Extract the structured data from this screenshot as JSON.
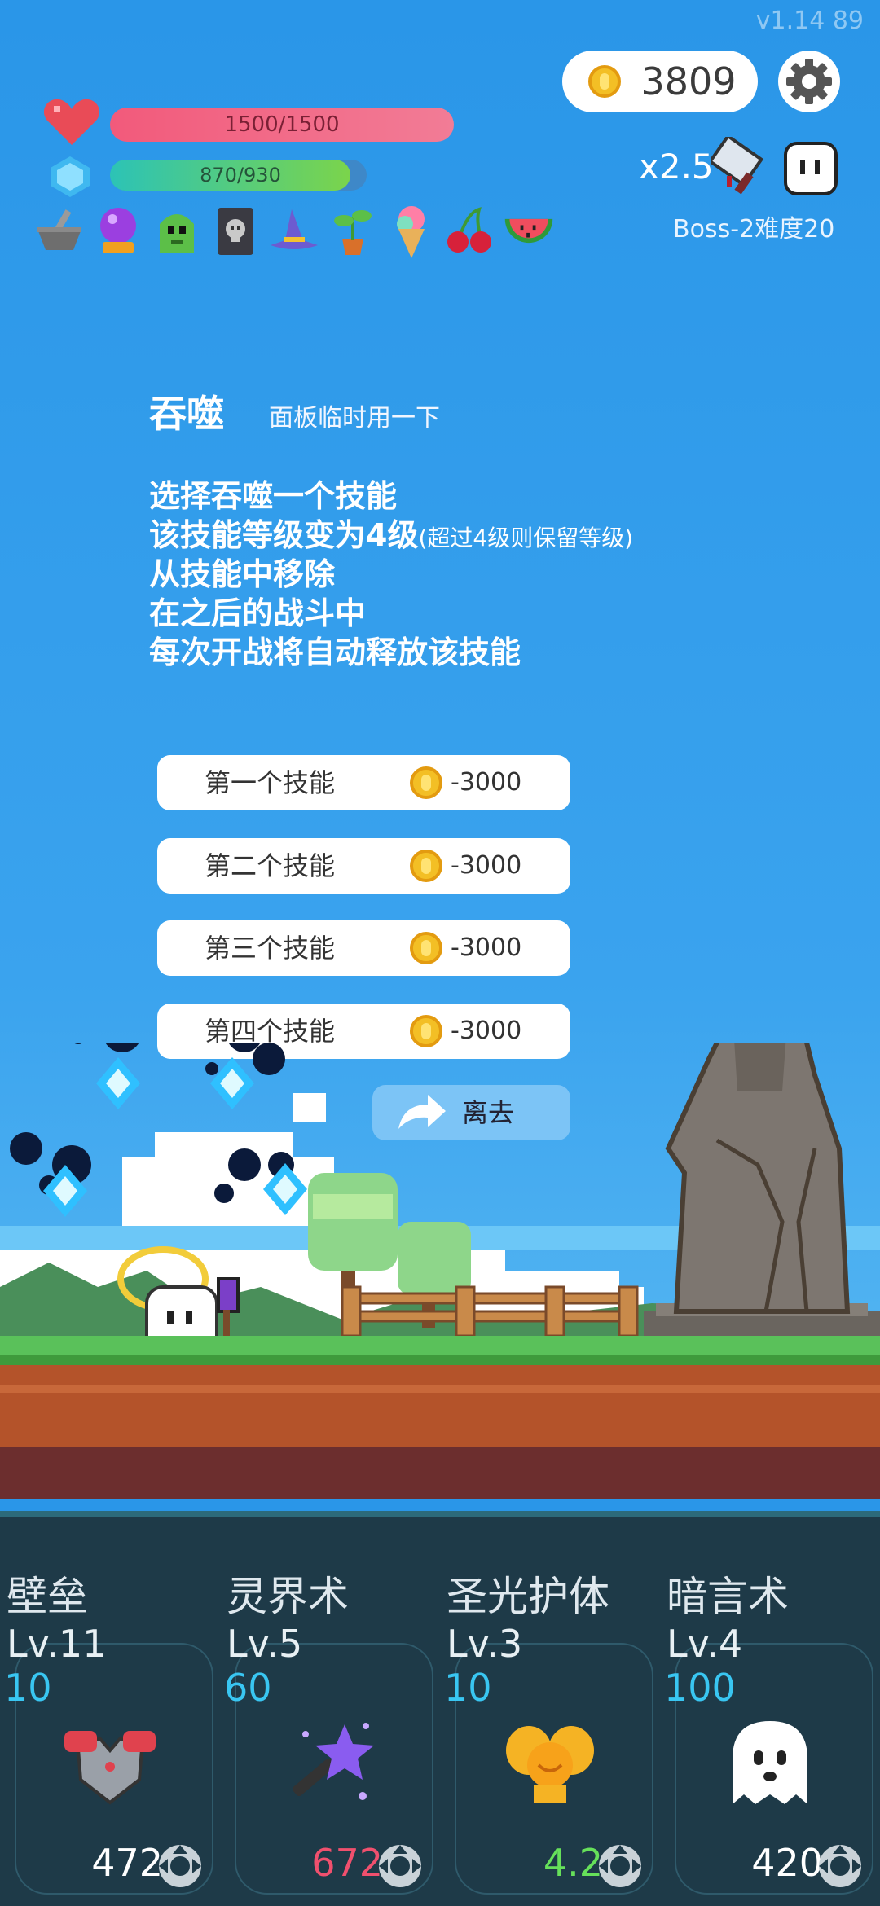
{
  "version": "v1.14   89",
  "coins": "3809",
  "hp": "1500/1500",
  "mp": "870/930",
  "mp_fraction": 0.935,
  "multiplier": "x2.5",
  "boss_info": "Boss-2难度20",
  "items": [
    "mortar",
    "crystal-ball",
    "slime",
    "skull-book",
    "wizard-hat",
    "sprout",
    "ice-cream",
    "cherries",
    "watermelon"
  ],
  "panel": {
    "title": "吞噬",
    "subtitle": "面板临时用一下",
    "lines": [
      "选择吞噬一个技能",
      "该技能等级变为4级",
      "(超过4级则保留等级)",
      "从技能中移除",
      "在之后的战斗中",
      "每次开战将自动释放该技能"
    ]
  },
  "options": [
    {
      "label": "第一个技能",
      "price": "-3000"
    },
    {
      "label": "第二个技能",
      "price": "-3000"
    },
    {
      "label": "第三个技能",
      "price": "-3000"
    },
    {
      "label": "第四个技能",
      "price": "-3000"
    }
  ],
  "leave_label": "离去",
  "skills": [
    {
      "name": "壁垒",
      "level": "Lv.11",
      "cost": "10",
      "value": "472",
      "value_color": "#ffffff",
      "icon": "armor-icon"
    },
    {
      "name": "灵界术",
      "level": "Lv.5",
      "cost": "60",
      "value": "672",
      "value_color": "#f0506e",
      "icon": "magic-wand-icon"
    },
    {
      "name": "圣光护体",
      "level": "Lv.3",
      "cost": "10",
      "value": "4.2",
      "value_color": "#66e05a",
      "icon": "golden-wings-icon"
    },
    {
      "name": "暗言术",
      "level": "Lv.4",
      "cost": "100",
      "value": "420",
      "value_color": "#ffffff",
      "icon": "ghost-icon"
    }
  ],
  "colors": {
    "sky": "#2a96e8",
    "hp": "#f25a7b",
    "mana": "#2cc3b6",
    "panel_bottom": "#1e3a48"
  }
}
